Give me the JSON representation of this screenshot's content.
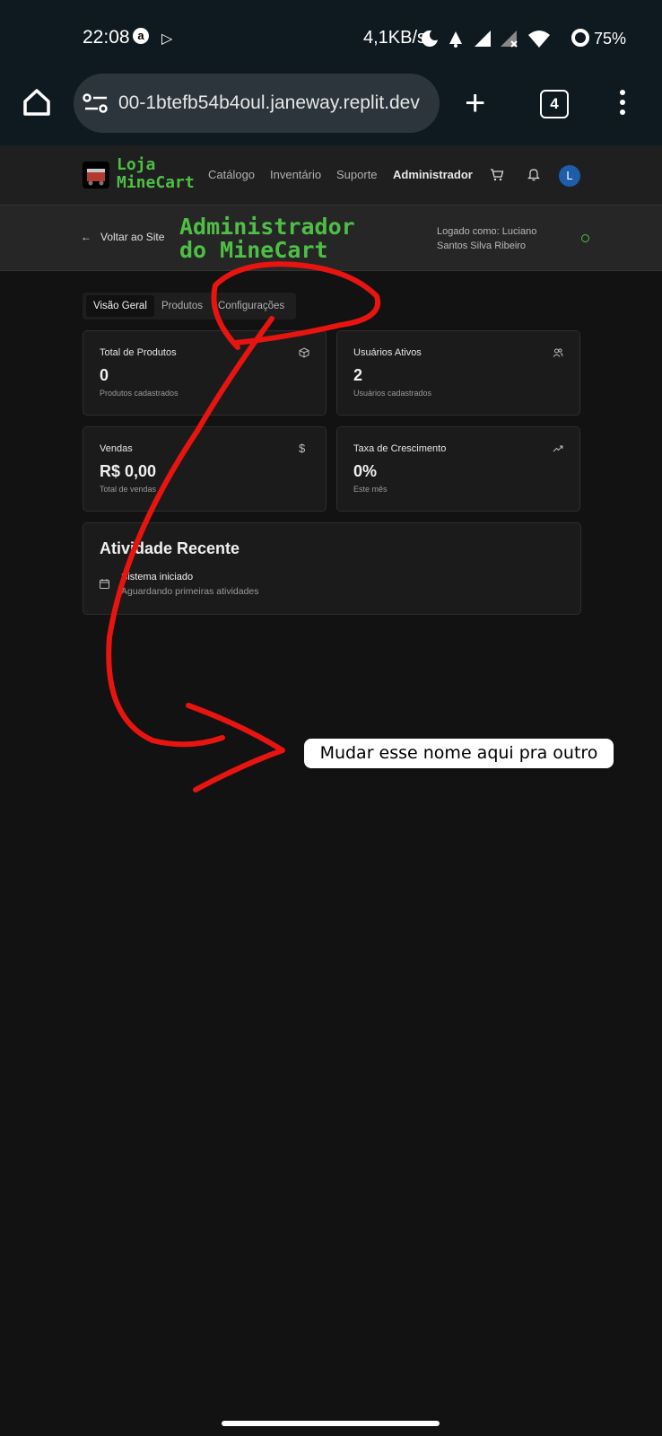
{
  "status_bar": {
    "time": "22:08",
    "net_speed": "4,1KB/s",
    "battery": "75%"
  },
  "browser": {
    "url": "00-1btefb54b4oul.janeway.replit.dev",
    "tab_count": "4"
  },
  "site_header": {
    "logo_line1": "Loja",
    "logo_line2": "MineCart",
    "nav": [
      "Catálogo",
      "Inventário",
      "Suporte",
      "Administrador"
    ],
    "avatar_initial": "L"
  },
  "admin_header": {
    "back_label": "Voltar ao Site",
    "title_line1": "Administrador",
    "title_line2": "do MineCart",
    "logged_line1": "Logado como: Luciano",
    "logged_line2": "Santos Silva Ribeiro"
  },
  "tabs": [
    "Visão Geral",
    "Produtos",
    "Configurações"
  ],
  "cards": [
    {
      "title": "Total de Produtos",
      "value": "0",
      "sub": "Produtos cadastrados",
      "icon": "box-icon"
    },
    {
      "title": "Usuários Ativos",
      "value": "2",
      "sub": "Usuários cadastrados",
      "icon": "users-icon"
    },
    {
      "title": "Vendas",
      "value": "R$ 0,00",
      "sub": "Total de vendas",
      "icon": "dollar-icon"
    },
    {
      "title": "Taxa de Crescimento",
      "value": "0%",
      "sub": "Este mês",
      "icon": "trending-up-icon"
    }
  ],
  "activity": {
    "title": "Atividade Recente",
    "item": "Sistema iniciado",
    "item_sub": "Aguardando primeiras atividades"
  },
  "annotation": {
    "note": "Mudar esse nome aqui pra outro",
    "color": "#e8140f"
  }
}
